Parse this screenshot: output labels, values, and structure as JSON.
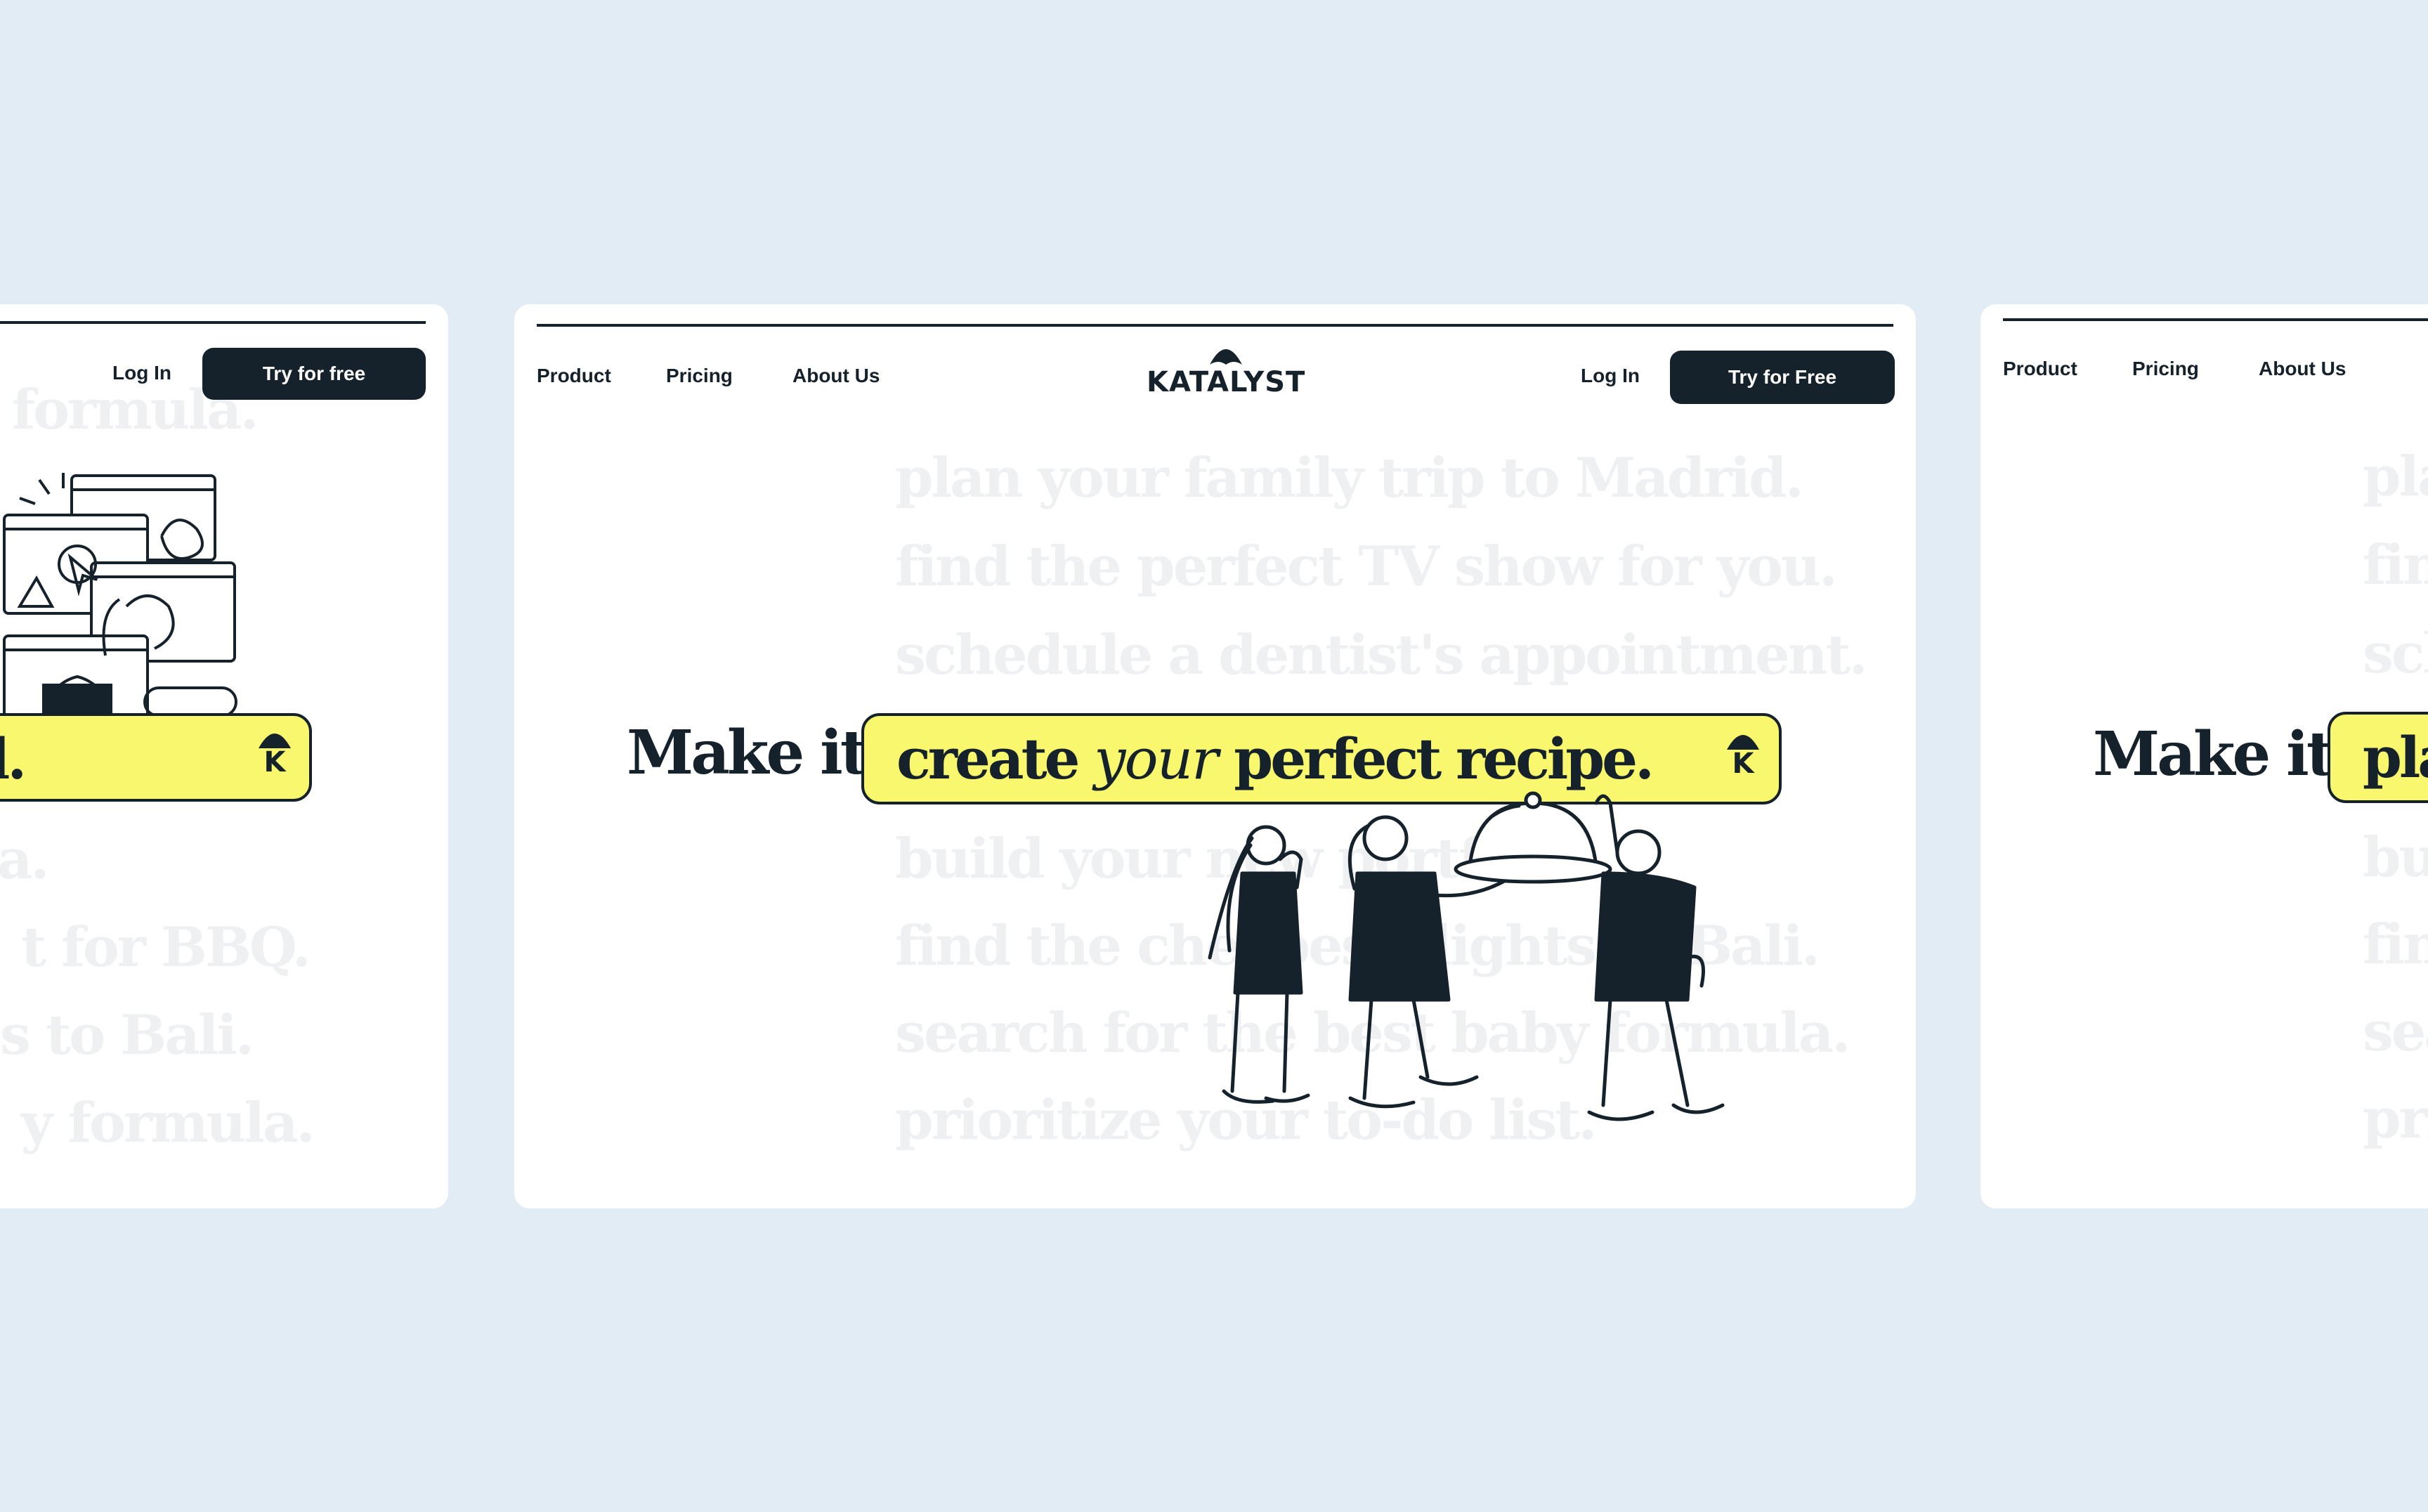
{
  "nav": {
    "product": "Product",
    "pricing": "Pricing",
    "about": "About Us",
    "login": "Log In",
    "try_center": "Try for Free",
    "try_left": "Try for free"
  },
  "brand": {
    "name": "KATALYST",
    "mark": "K",
    "accent": "#f8f76d",
    "ink": "#16222b",
    "background": "#e1ecf4"
  },
  "hero": {
    "prefix": "Make it",
    "phrase_before": "create ",
    "phrase_script": "your",
    "phrase_after": " perfect recipe.",
    "left_fragment": "l.",
    "right_fragment": "pla"
  },
  "suggestions_center": [
    "plan your family trip to Madrid.",
    "find the perfect TV show for you.",
    "schedule a dentist's appointment.",
    "build your new portfolio.",
    "find the cheapest flights to Bali.",
    "search for the best baby formula.",
    "prioritize your to-do list."
  ],
  "suggestions_left": [
    "y formula.",
    "a.",
    "t for BBQ.",
    "s to Bali.",
    "y formula."
  ],
  "suggestions_right": [
    "pla",
    "fin",
    "sch",
    "bu",
    "fin",
    "sea",
    "pri"
  ],
  "icons": [
    "katalyst-umbrella-icon",
    "k-mark-icon",
    "people-serving-dish-illustration",
    "video-call-windows-illustration"
  ]
}
